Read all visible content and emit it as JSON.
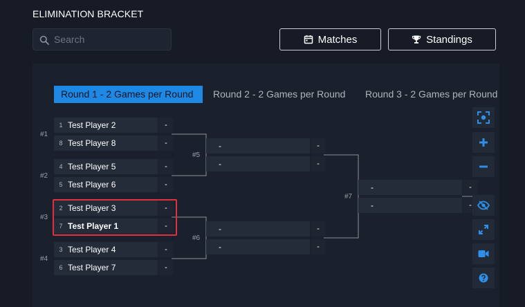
{
  "header": {
    "title": "ELIMINATION BRACKET"
  },
  "search": {
    "placeholder": "Search"
  },
  "toolbar": {
    "matches_label": "Matches",
    "standings_label": "Standings"
  },
  "rounds": [
    {
      "label": "Round 1 - 2 Games per Round",
      "active": true
    },
    {
      "label": "Round 2 - 2 Games per Round",
      "active": false
    },
    {
      "label": "Round 3 - 2 Games per Round",
      "active": false
    }
  ],
  "round1": {
    "matches": [
      {
        "label": "#1",
        "slots": [
          {
            "seed": "1",
            "name": "Test Player 2",
            "score": "-"
          },
          {
            "seed": "8",
            "name": "Test Player 8",
            "score": "-"
          }
        ]
      },
      {
        "label": "#2",
        "slots": [
          {
            "seed": "4",
            "name": "Test Player 5",
            "score": "-"
          },
          {
            "seed": "5",
            "name": "Test Player 6",
            "score": "-"
          }
        ]
      },
      {
        "label": "#3",
        "slots": [
          {
            "seed": "2",
            "name": "Test Player 3",
            "score": "-"
          },
          {
            "seed": "7",
            "name": "Test Player 1",
            "score": "-"
          }
        ]
      },
      {
        "label": "#4",
        "slots": [
          {
            "seed": "3",
            "name": "Test Player 4",
            "score": "-"
          },
          {
            "seed": "6",
            "name": "Test Player 7",
            "score": "-"
          }
        ]
      }
    ]
  },
  "round2": {
    "matches": [
      {
        "label": "#5",
        "slots": [
          {
            "name": "-",
            "score": "-"
          },
          {
            "name": "-",
            "score": "-"
          }
        ]
      },
      {
        "label": "#6",
        "slots": [
          {
            "name": "-",
            "score": "-"
          },
          {
            "name": "-",
            "score": "-"
          }
        ]
      }
    ]
  },
  "round3": {
    "matches": [
      {
        "label": "#7",
        "slots": [
          {
            "name": "-",
            "score": "-"
          },
          {
            "name": "-",
            "score": "-"
          }
        ]
      }
    ]
  },
  "tools": [
    {
      "icon": "fit-view-icon",
      "color": "#2f8fe8"
    },
    {
      "icon": "zoom-in-icon",
      "color": "#2f8fe8"
    },
    {
      "icon": "zoom-out-icon",
      "color": "#2f8fe8"
    },
    {
      "icon": "hide-icon",
      "color": "#2f8fe8"
    },
    {
      "icon": "expand-icon",
      "color": "#2f8fe8"
    },
    {
      "icon": "video-icon",
      "color": "#2f8fe8"
    },
    {
      "icon": "help-icon",
      "color": "#2f8fe8"
    }
  ],
  "colors": {
    "accent": "#1e88e5",
    "highlight": "#e0313f",
    "background": "#161b25",
    "panel": "#1b212c",
    "slot": "#252c39"
  }
}
